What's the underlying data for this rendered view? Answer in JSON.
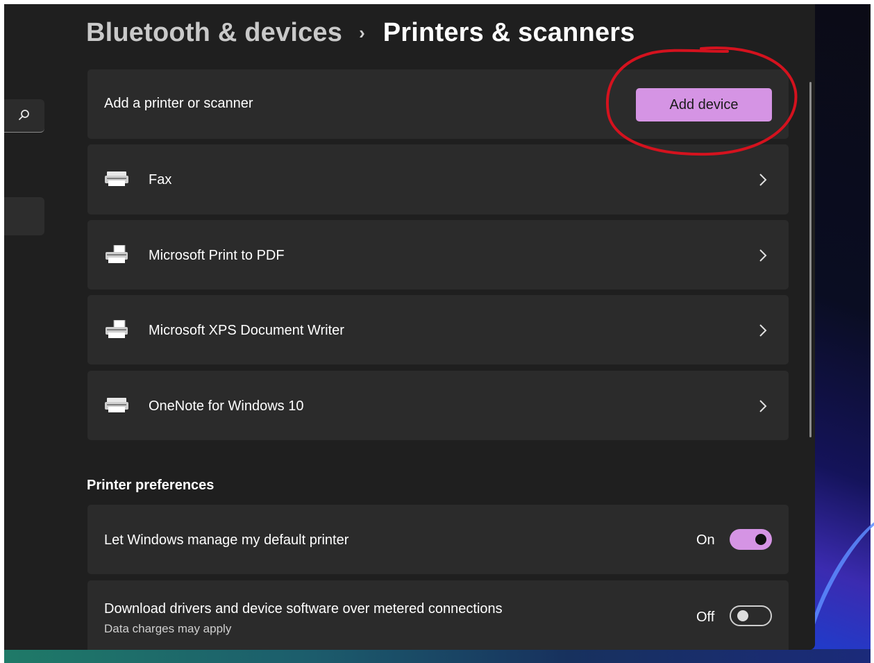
{
  "breadcrumb": {
    "parent": "Bluetooth & devices",
    "separator": "›",
    "current": "Printers & scanners"
  },
  "add_printer": {
    "label": "Add a printer or scanner",
    "button_label": "Add device"
  },
  "printers": [
    {
      "name": "Fax",
      "icon": "fax-printer-icon"
    },
    {
      "name": "Microsoft Print to PDF",
      "icon": "document-printer-icon"
    },
    {
      "name": "Microsoft XPS Document Writer",
      "icon": "document-printer-icon"
    },
    {
      "name": "OneNote for Windows 10",
      "icon": "fax-printer-icon"
    }
  ],
  "preferences": {
    "title": "Printer preferences",
    "items": [
      {
        "label": "Let Windows manage my default printer",
        "state_label": "On",
        "enabled": true
      },
      {
        "label": "Download drivers and device software over metered connections",
        "sublabel": "Data charges may apply",
        "state_label": "Off",
        "enabled": false
      }
    ]
  },
  "colors": {
    "accent": "#d594e4",
    "window_bg": "#1f1f1f",
    "card_bg": "#2b2b2b",
    "annotation": "#d4121e"
  },
  "icons": {
    "nav_search": "search-icon",
    "row_chevron": "chevron-right-icon"
  }
}
